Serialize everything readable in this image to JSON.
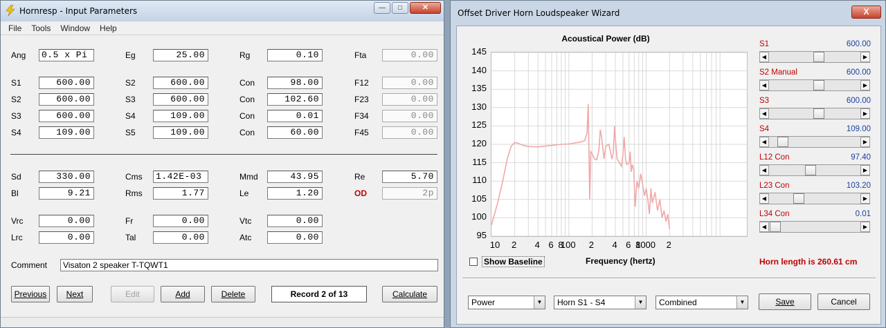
{
  "left": {
    "title": "Hornresp - Input Parameters",
    "menu": [
      "File",
      "Tools",
      "Window",
      "Help"
    ],
    "rows": {
      "r1": [
        {
          "label": "Ang",
          "value": "0.5 x Pi",
          "align": "left"
        },
        {
          "label": "Eg",
          "value": "25.00"
        },
        {
          "label": "Rg",
          "value": "0.10"
        },
        {
          "label": "Fta",
          "value": "0.00",
          "grey": true
        }
      ],
      "r2": [
        {
          "label": "S1",
          "value": "600.00"
        },
        {
          "label": "S2",
          "value": "600.00"
        },
        {
          "label": "Con",
          "value": "98.00"
        },
        {
          "label": "F12",
          "value": "0.00",
          "grey": true
        }
      ],
      "r3": [
        {
          "label": "S2",
          "value": "600.00"
        },
        {
          "label": "S3",
          "value": "600.00"
        },
        {
          "label": "Con",
          "value": "102.60"
        },
        {
          "label": "F23",
          "value": "0.00",
          "grey": true
        }
      ],
      "r4": [
        {
          "label": "S3",
          "value": "600.00"
        },
        {
          "label": "S4",
          "value": "109.00"
        },
        {
          "label": "Con",
          "value": "0.01"
        },
        {
          "label": "F34",
          "value": "0.00",
          "grey": true
        }
      ],
      "r5": [
        {
          "label": "S4",
          "value": "109.00"
        },
        {
          "label": "S5",
          "value": "109.00"
        },
        {
          "label": "Con",
          "value": "60.00"
        },
        {
          "label": "F45",
          "value": "0.00",
          "grey": true
        }
      ],
      "r6": [
        {
          "label": "Sd",
          "value": "330.00"
        },
        {
          "label": "Cms",
          "value": "1.42E-03",
          "align": "left"
        },
        {
          "label": "Mmd",
          "value": "43.95"
        },
        {
          "label": "Re",
          "value": "5.70"
        }
      ],
      "r7": [
        {
          "label": "Bl",
          "value": "9.21"
        },
        {
          "label": "Rms",
          "value": "1.77"
        },
        {
          "label": "Le",
          "value": "1.20"
        },
        {
          "label": "OD",
          "value": "2p",
          "grey": true,
          "red": true
        }
      ],
      "r8": [
        {
          "label": "Vrc",
          "value": "0.00"
        },
        {
          "label": "Fr",
          "value": "0.00"
        },
        {
          "label": "Vtc",
          "value": "0.00"
        }
      ],
      "r9": [
        {
          "label": "Lrc",
          "value": "0.00"
        },
        {
          "label": "Tal",
          "value": "0.00"
        },
        {
          "label": "Atc",
          "value": "0.00"
        }
      ]
    },
    "comment_label": "Comment",
    "comment_value": "Visaton 2 speaker T-TQWT1",
    "buttons": {
      "previous": "Previous",
      "next": "Next",
      "edit": "Edit",
      "add": "Add",
      "delete": "Delete",
      "calculate": "Calculate"
    },
    "record": "Record 2 of 13"
  },
  "right": {
    "title": "Offset Driver Horn Loudspeaker Wizard",
    "close_label": "X",
    "sliders": [
      {
        "label": "S1",
        "value": "600.00",
        "pos": 0.55
      },
      {
        "label": "S2  Manual",
        "value": "600.00",
        "pos": 0.55
      },
      {
        "label": "S3",
        "value": "600.00",
        "pos": 0.55
      },
      {
        "label": "S4",
        "value": "109.00",
        "pos": 0.1
      },
      {
        "label": "L12  Con",
        "value": "97.40",
        "pos": 0.45
      },
      {
        "label": "L23  Con",
        "value": "103.20",
        "pos": 0.3
      },
      {
        "label": "L34  Con",
        "value": "0.01",
        "pos": 0.0
      }
    ],
    "horn_length": "Horn length is 260.61 cm",
    "show_baseline": "Show Baseline",
    "combos": {
      "mode": "Power",
      "horn": "Horn S1 - S4",
      "combined": "Combined"
    },
    "buttons": {
      "save": "Save",
      "cancel": "Cancel"
    }
  },
  "chart_data": {
    "type": "line",
    "title": "Acoustical Power (dB)",
    "xlabel": "Frequency (hertz)",
    "ylabel": "",
    "x_scale": "log",
    "xlim": [
      10,
      20000
    ],
    "ylim": [
      95,
      145
    ],
    "yticks": [
      95,
      100,
      105,
      110,
      115,
      120,
      125,
      130,
      135,
      140,
      145
    ],
    "xtick_labels": [
      "10",
      "2",
      "4",
      "6",
      "8",
      "100",
      "2",
      "4",
      "6",
      "8",
      "1000",
      "2"
    ],
    "xtick_values": [
      10,
      20,
      40,
      60,
      80,
      100,
      200,
      400,
      600,
      800,
      1000,
      2000
    ],
    "grid": true,
    "line_color": "#f0a8a8",
    "series": [
      {
        "points": [
          [
            10,
            98
          ],
          [
            12,
            104
          ],
          [
            14,
            110
          ],
          [
            16,
            116
          ],
          [
            18,
            119.5
          ],
          [
            20,
            120.5
          ],
          [
            22,
            120.3
          ],
          [
            25,
            119.8
          ],
          [
            30,
            119.4
          ],
          [
            40,
            119.3
          ],
          [
            60,
            119.7
          ],
          [
            80,
            120
          ],
          [
            100,
            120.1
          ],
          [
            140,
            120.6
          ],
          [
            160,
            121
          ],
          [
            172,
            123
          ],
          [
            178,
            131
          ],
          [
            182,
            118
          ],
          [
            186,
            105
          ],
          [
            192,
            118
          ],
          [
            200,
            117.5
          ],
          [
            215,
            116
          ],
          [
            230,
            115.8
          ],
          [
            245,
            118.5
          ],
          [
            255,
            124
          ],
          [
            265,
            122
          ],
          [
            285,
            116
          ],
          [
            300,
            119.5
          ],
          [
            330,
            120
          ],
          [
            345,
            118
          ],
          [
            360,
            116
          ],
          [
            375,
            117.5
          ],
          [
            390,
            125
          ],
          [
            405,
            120
          ],
          [
            420,
            116
          ],
          [
            450,
            115
          ],
          [
            480,
            114
          ],
          [
            500,
            117
          ],
          [
            520,
            122
          ],
          [
            540,
            116
          ],
          [
            560,
            114.5
          ],
          [
            600,
            115
          ],
          [
            620,
            118
          ],
          [
            640,
            112.5
          ],
          [
            660,
            114.5
          ],
          [
            690,
            113
          ],
          [
            720,
            103
          ],
          [
            760,
            110
          ],
          [
            800,
            108
          ],
          [
            850,
            112
          ],
          [
            900,
            109
          ],
          [
            950,
            106
          ],
          [
            1000,
            108
          ],
          [
            1050,
            105
          ],
          [
            1100,
            101
          ],
          [
            1150,
            108
          ],
          [
            1200,
            104
          ],
          [
            1300,
            107
          ],
          [
            1400,
            102
          ],
          [
            1500,
            105
          ],
          [
            1600,
            100
          ],
          [
            1700,
            102
          ],
          [
            1800,
            99
          ],
          [
            1900,
            101
          ],
          [
            2000,
            97
          ]
        ]
      }
    ]
  }
}
